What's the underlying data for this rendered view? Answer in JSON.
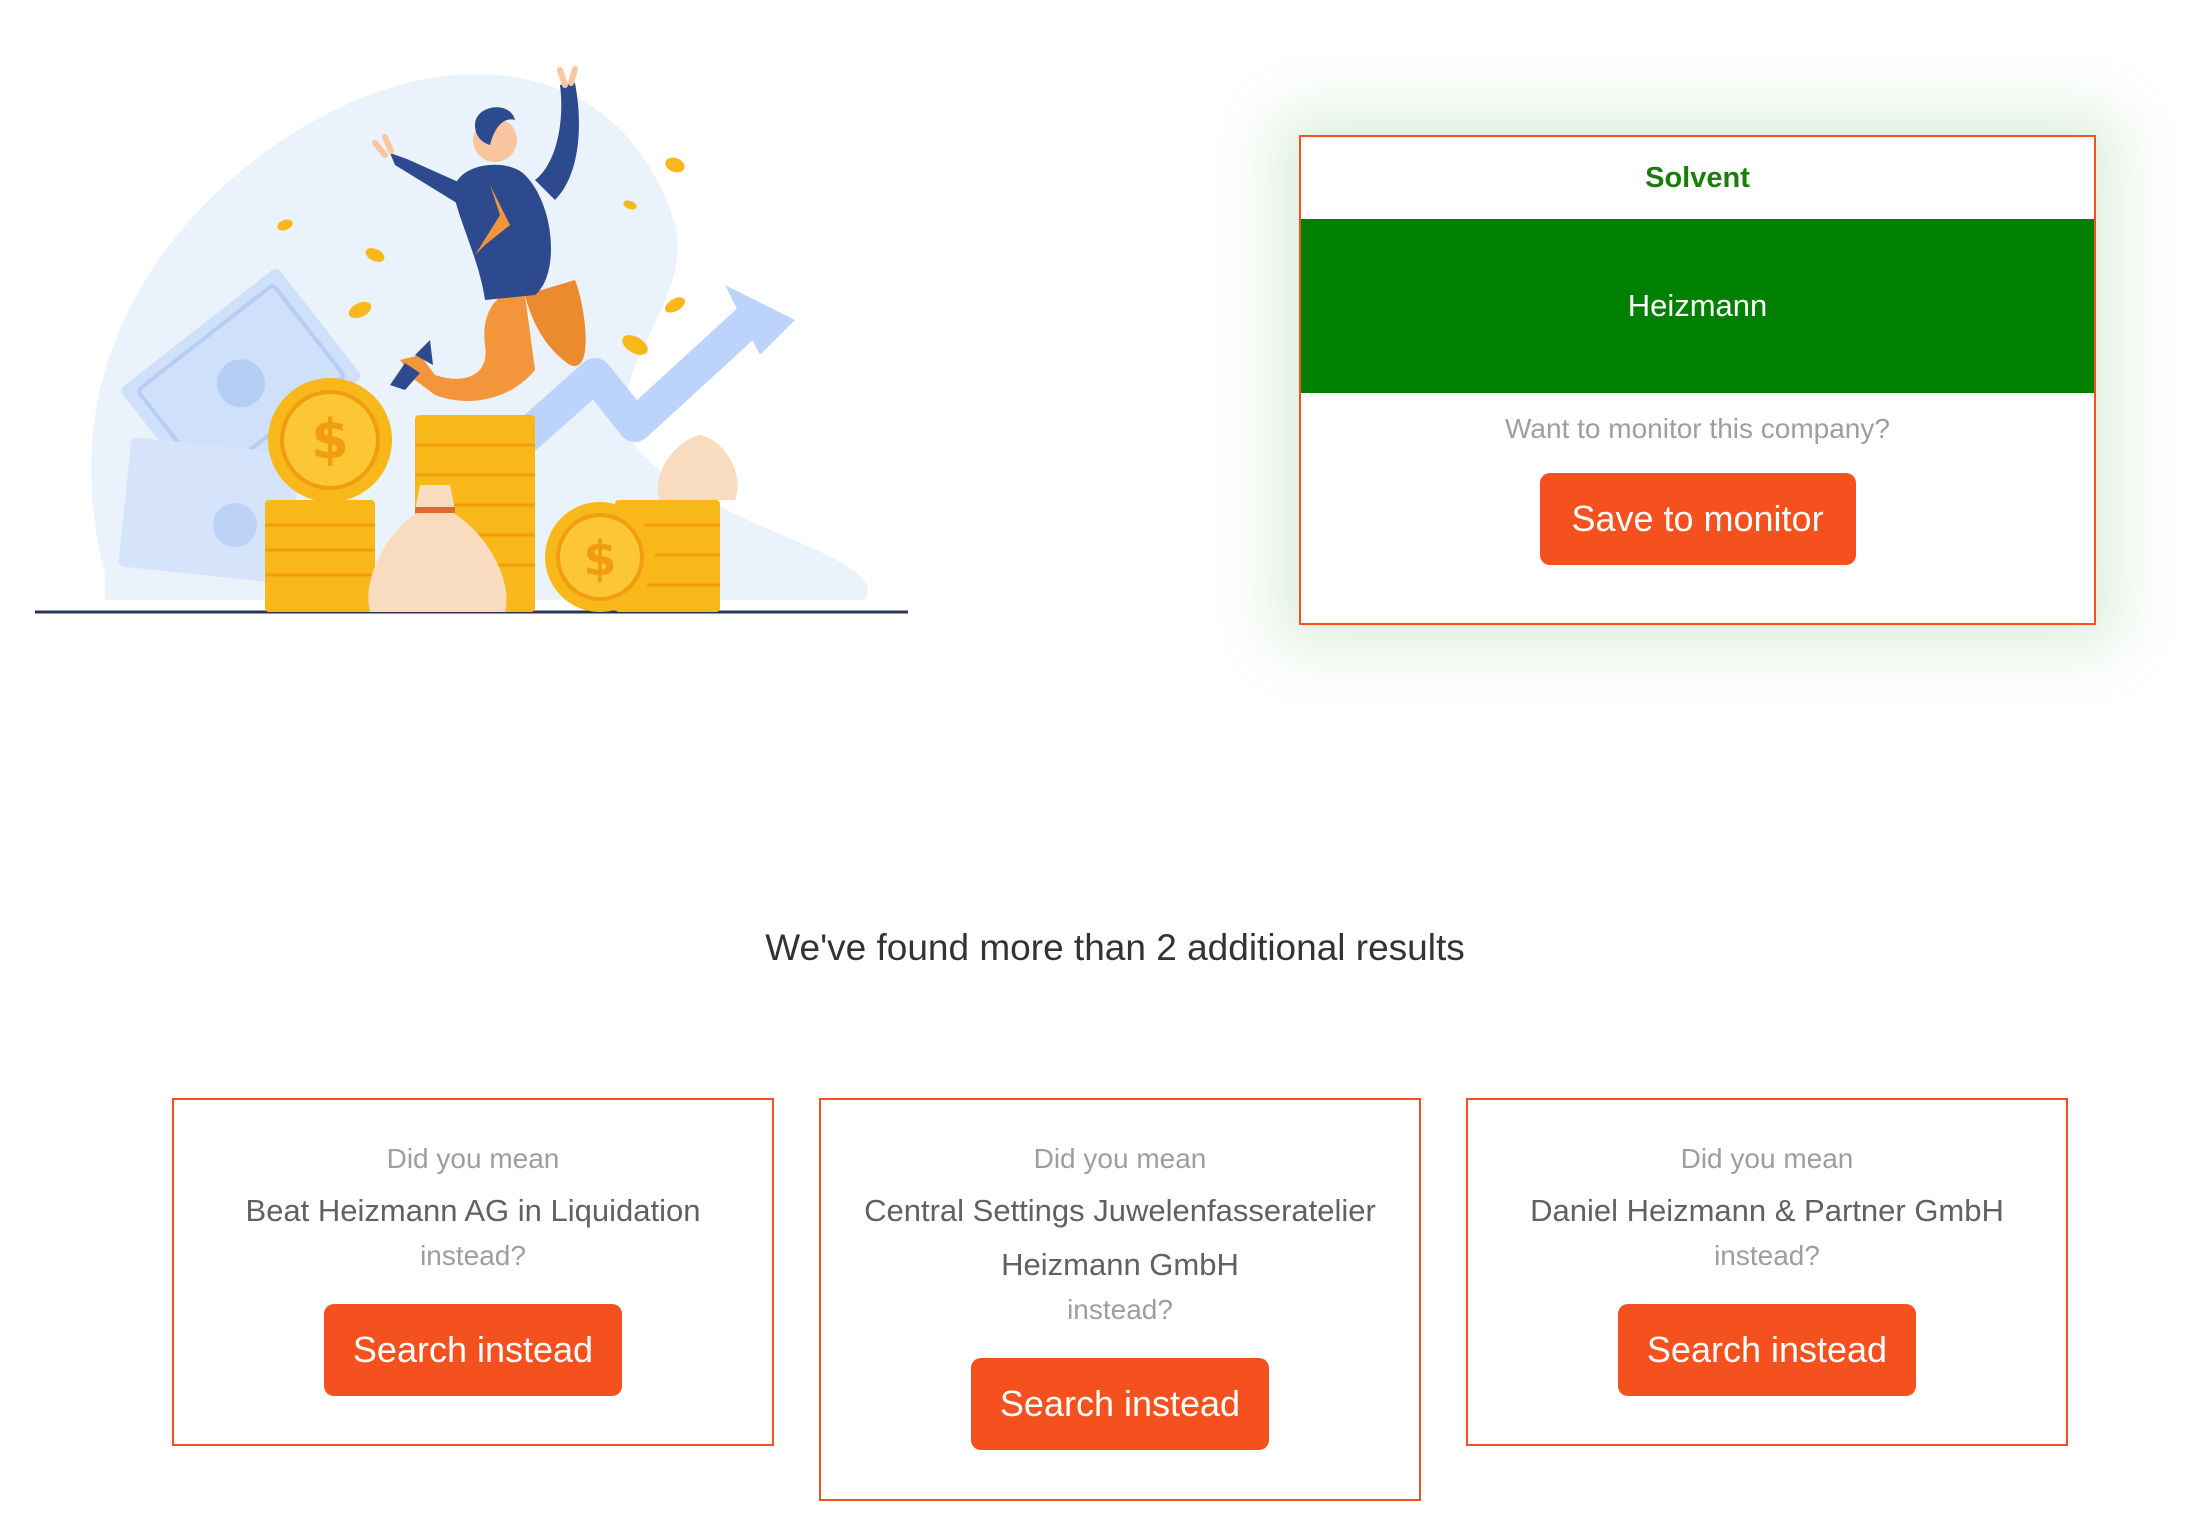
{
  "colors": {
    "accent": "#f4511e",
    "solvent_green": "#008000",
    "status_text": "#1b7d0b"
  },
  "hero": {
    "illustration": "businessman-jumping-with-coins-illustration"
  },
  "result": {
    "status": "Solvent",
    "company_name": "Heizmann",
    "monitor_prompt": "Want to monitor this company?",
    "save_label": "Save to monitor"
  },
  "additional": {
    "heading": "We've found more than 2 additional results",
    "suggestions": [
      {
        "prefix": "Did you mean",
        "company": "Beat Heizmann AG in Liquidation",
        "suffix": "instead?",
        "button_label": "Search instead"
      },
      {
        "prefix": "Did you mean",
        "company": "Central Settings Juwelenfasseratelier Heizmann GmbH",
        "suffix": "instead?",
        "button_label": "Search instead"
      },
      {
        "prefix": "Did you mean",
        "company": "Daniel Heizmann & Partner GmbH",
        "suffix": "instead?",
        "button_label": "Search instead"
      }
    ]
  }
}
